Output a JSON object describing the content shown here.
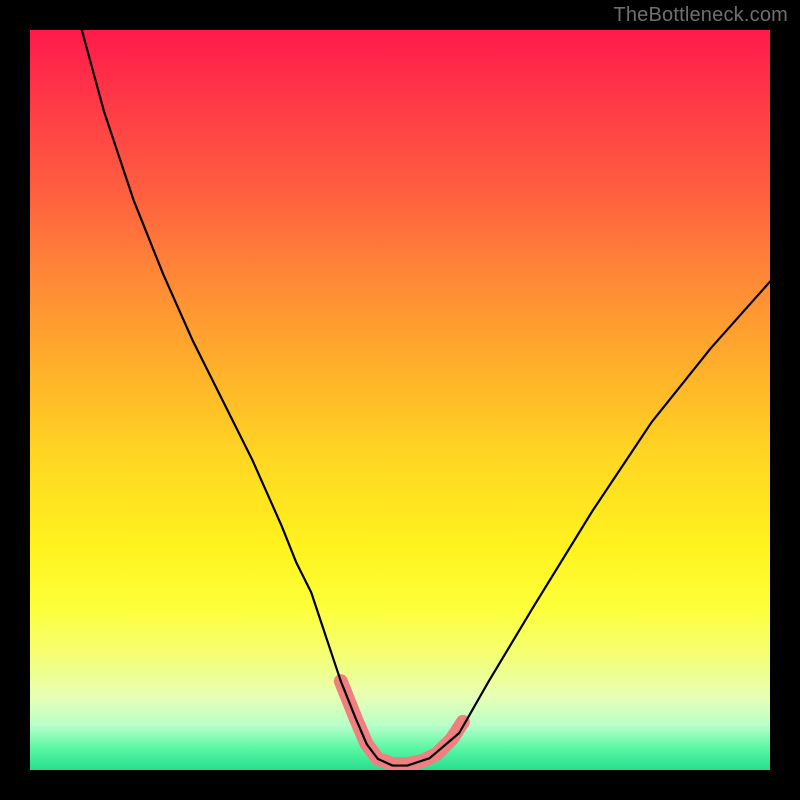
{
  "watermark": "TheBottleneck.com",
  "chart_data": {
    "type": "line",
    "title": "",
    "xlabel": "",
    "ylabel": "",
    "xlim": [
      0,
      100
    ],
    "ylim": [
      0,
      100
    ],
    "series": [
      {
        "name": "bottleneck-curve",
        "x": [
          7,
          10,
          14,
          18,
          22,
          26,
          30,
          34,
          36,
          38,
          40,
          42,
          44,
          45.5,
          47,
          49,
          51,
          54,
          58,
          62,
          68,
          76,
          84,
          92,
          100
        ],
        "values": [
          100,
          89,
          77,
          67,
          58,
          50,
          42,
          33,
          28,
          24,
          18,
          12,
          7,
          3.5,
          1.5,
          0.6,
          0.6,
          1.6,
          5,
          12,
          22,
          35,
          47,
          57,
          66
        ]
      }
    ],
    "overlay": {
      "name": "highlight-segment",
      "color": "#f08080",
      "stroke_width": 14,
      "points": [
        {
          "x": 42.0,
          "y": 12.0
        },
        {
          "x": 44.0,
          "y": 7.0
        },
        {
          "x": 45.5,
          "y": 3.5
        },
        {
          "x": 47.0,
          "y": 1.5
        },
        {
          "x": 49.0,
          "y": 0.8
        },
        {
          "x": 51.0,
          "y": 0.8
        },
        {
          "x": 53.0,
          "y": 1.2
        },
        {
          "x": 55.0,
          "y": 2.2
        },
        {
          "x": 57.0,
          "y": 4.2
        },
        {
          "x": 58.5,
          "y": 6.5
        }
      ]
    },
    "gradient_stops": [
      {
        "pos": 0,
        "color": "#ff1a4a"
      },
      {
        "pos": 0.7,
        "color": "#fff31e"
      },
      {
        "pos": 1.0,
        "color": "#24df8e"
      }
    ]
  }
}
